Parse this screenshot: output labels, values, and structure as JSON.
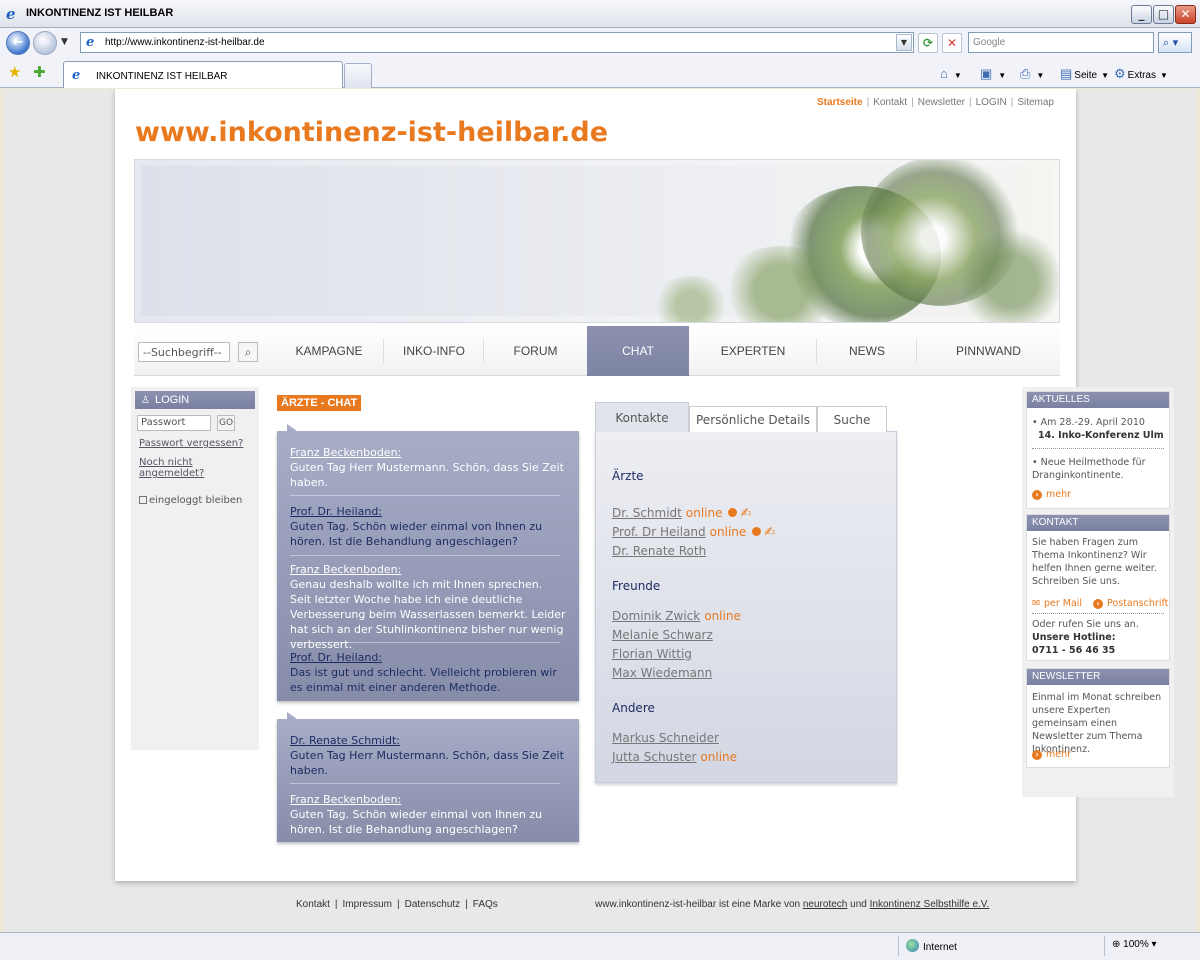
{
  "window": {
    "title": "INKONTINENZ IST HEILBAR",
    "min_glyph": "_",
    "max_glyph": "□",
    "close_glyph": "✕"
  },
  "address": {
    "url": "http://www.inkontinenz-ist-heilbar.de",
    "search_placeholder": "Google"
  },
  "tab": {
    "label": "INKONTINENZ IST HEILBAR"
  },
  "commandbar": {
    "page_label": "Seite",
    "tools_label": "Extras"
  },
  "topnav": [
    {
      "label": "Startseite",
      "active": true
    },
    {
      "label": "Kontakt"
    },
    {
      "label": "Newsletter"
    },
    {
      "label": "LOGIN"
    },
    {
      "label": "Sitemap"
    }
  ],
  "site": {
    "logo_text": "www.inkontinenz-ist-heilbar.de"
  },
  "mainnav": {
    "search_placeholder": "--Suchbegriff--",
    "items": [
      {
        "label": "KAMPAGNE"
      },
      {
        "label": "INKO-INFO"
      },
      {
        "label": "FORUM"
      },
      {
        "label": "CHAT",
        "active": true
      },
      {
        "label": "EXPERTEN"
      },
      {
        "label": "NEWS"
      },
      {
        "label": "PINNWAND"
      }
    ]
  },
  "login": {
    "heading": "LOGIN",
    "password_placeholder": "Passwort",
    "go_label": "GO",
    "forgot_label": "Passwort vergessen?",
    "register_label": "Noch nicht angemeldet?",
    "stay_label": "eingeloggt bleiben"
  },
  "chat": {
    "title": "ÄRZTE - CHAT",
    "thread1": [
      {
        "who": "Franz Beckenboden:",
        "text": "Guten Tag Herr Mustermann. Schön, dass Sie Zeit haben."
      },
      {
        "who": "Prof. Dr. Heiland:",
        "text": "Guten Tag. Schön wieder einmal von Ihnen zu hören. Ist die Behandlung angeschlagen?"
      },
      {
        "who": "Franz Beckenboden:",
        "text": "Genau deshalb wollte ich mit Ihnen sprechen. Seit letzter Woche habe ich eine deutliche Verbesserung beim Wasserlassen bemerkt. Leider hat sich an der Stuhlinkontinenz bisher nur wenig verbessert."
      },
      {
        "who": "Prof. Dr. Heiland:",
        "text": "Das ist gut und schlecht. Vielleicht probieren wir es einmal mit einer anderen Methode."
      }
    ],
    "thread2": [
      {
        "who": "Dr. Renate Schmidt:",
        "text": "Guten Tag Herr Mustermann. Schön, dass Sie Zeit haben."
      },
      {
        "who": "Franz Beckenboden:",
        "text": "Guten Tag. Schön wieder einmal von Ihnen zu hören. Ist die Behandlung angeschlagen?"
      }
    ]
  },
  "contacts": {
    "tabs": [
      "Kontakte",
      "Persönliche Details",
      "Suche"
    ],
    "online_label": "online",
    "groups": {
      "aerzte": "Ärzte",
      "freunde": "Freunde",
      "andere": "Andere"
    },
    "aerzte": [
      "Dr. Schmidt",
      "Prof. Dr Heiland",
      "Dr. Renate Roth"
    ],
    "freunde": [
      "Dominik Zwick",
      "Melanie Schwarz",
      "Florian Wittig",
      "Max Wiedemann"
    ],
    "andere": [
      "Markus Schneider",
      "Jutta Schuster"
    ]
  },
  "sidebar": {
    "aktuelles": {
      "heading": "AKTUELLES",
      "item1_date": "Am 28.-29. April 2010",
      "item1_title": "14. Inko-Konferenz Ulm",
      "item2": "Neue Heilmethode für Dranginkontinente.",
      "more": "mehr"
    },
    "kontakt": {
      "heading": "KONTAKT",
      "text": "Sie haben Fragen zum Thema Inkontinenz? Wir helfen Ihnen gerne weiter. Schreiben Sie uns.",
      "mail_label": "per Mail",
      "post_label": "Postanschrift",
      "call_text": "Oder rufen Sie uns an.",
      "hotline_label": "Unsere Hotline:",
      "hotline_number": "0711 - 56 46 35"
    },
    "newsletter": {
      "heading": "NEWSLETTER",
      "text": "Einmal im Monat schreiben unsere Experten gemeinsam einen Newsletter zum Thema Inkontinenz.",
      "more": "mehr"
    }
  },
  "footer": {
    "links": [
      "Kontakt",
      "Impressum",
      "Datenschutz",
      "FAQs"
    ],
    "brand_prefix": "www.inkontinenz-ist-heilbar ist eine Marke von",
    "brand1": "neurotech",
    "brand_and": "und",
    "brand2": "Inkontinenz Selbsthilfe e.V."
  },
  "status": {
    "zone": "Internet",
    "zoom": "100%"
  },
  "colors": {
    "accent": "#e8791f",
    "nav_active": "#8088a6",
    "dark_text": "#1d2c63"
  }
}
